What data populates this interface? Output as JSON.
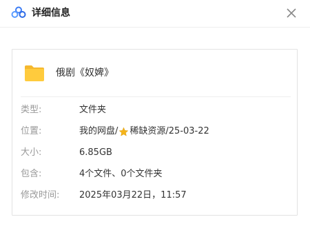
{
  "header": {
    "title": "详细信息"
  },
  "file": {
    "name": "俄剧《奴婢》"
  },
  "details": {
    "type": {
      "label": "类型:",
      "value": "文件夹"
    },
    "location": {
      "label": "位置:",
      "path_prefix": "我的网盘/",
      "path_suffix": "稀缺资源/25-03-22"
    },
    "size": {
      "label": "大小:",
      "value": "6.85GB"
    },
    "contains": {
      "label": "包含:",
      "value": "4个文件、0个文件夹"
    },
    "modified": {
      "label": "修改时间:",
      "value": "2025年03月22日，11:57"
    }
  },
  "icons": {
    "header": "cloud-logo-icon",
    "close": "close-icon",
    "folder": "folder-icon",
    "star": "star-icon"
  },
  "colors": {
    "folder": "#FFCB3D",
    "star": "#F5B41A",
    "label": "#999999",
    "value": "#333333"
  }
}
